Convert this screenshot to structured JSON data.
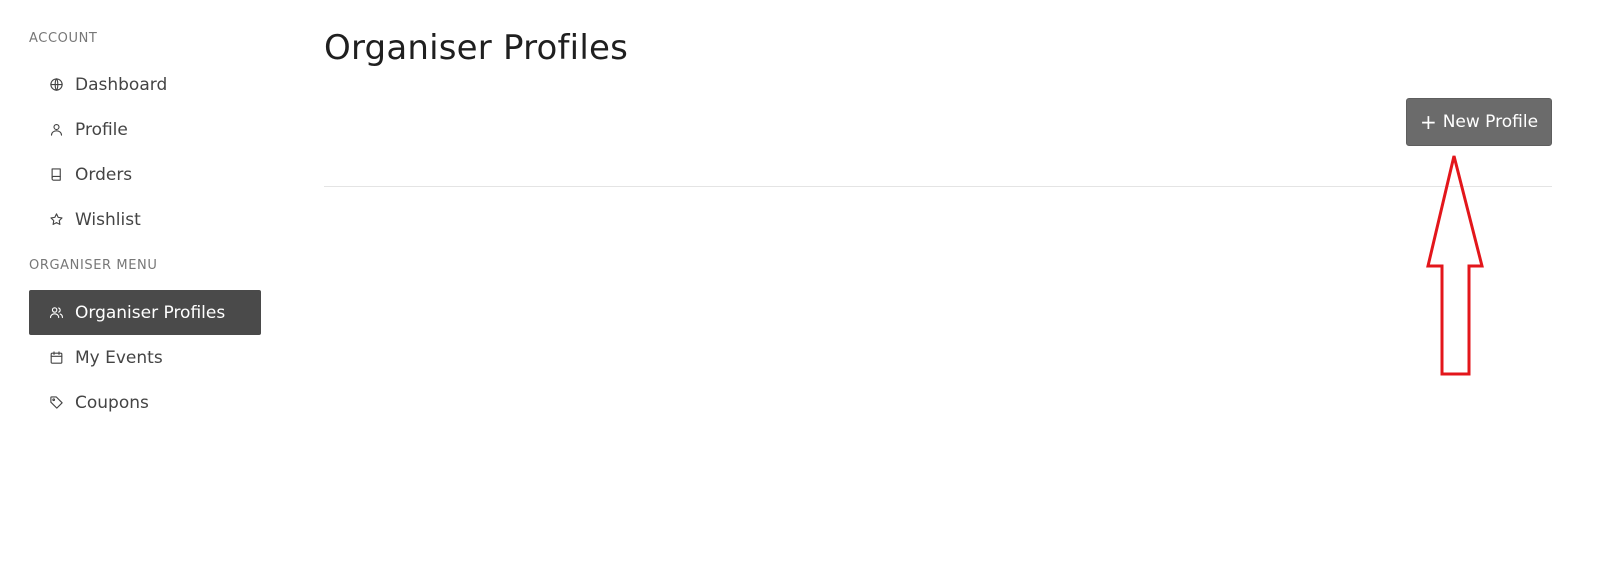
{
  "sidebar": {
    "account_title": "ACCOUNT",
    "account_items": [
      {
        "label": "Dashboard",
        "icon": "globe-icon"
      },
      {
        "label": "Profile",
        "icon": "user-icon"
      },
      {
        "label": "Orders",
        "icon": "book-icon"
      },
      {
        "label": "Wishlist",
        "icon": "star-icon"
      }
    ],
    "organiser_title": "ORGANISER MENU",
    "organiser_items": [
      {
        "label": "Organiser Profiles",
        "icon": "users-icon",
        "active": true
      },
      {
        "label": "My Events",
        "icon": "calendar-icon"
      },
      {
        "label": "Coupons",
        "icon": "tag-icon"
      }
    ]
  },
  "main": {
    "title": "Organiser Profiles",
    "new_profile_button": {
      "plus": "+",
      "label": "New Profile"
    }
  },
  "colors": {
    "active_nav_bg": "#4a4a4a",
    "button_bg": "#6b6b6b",
    "annotation_arrow": "#e3161b"
  }
}
